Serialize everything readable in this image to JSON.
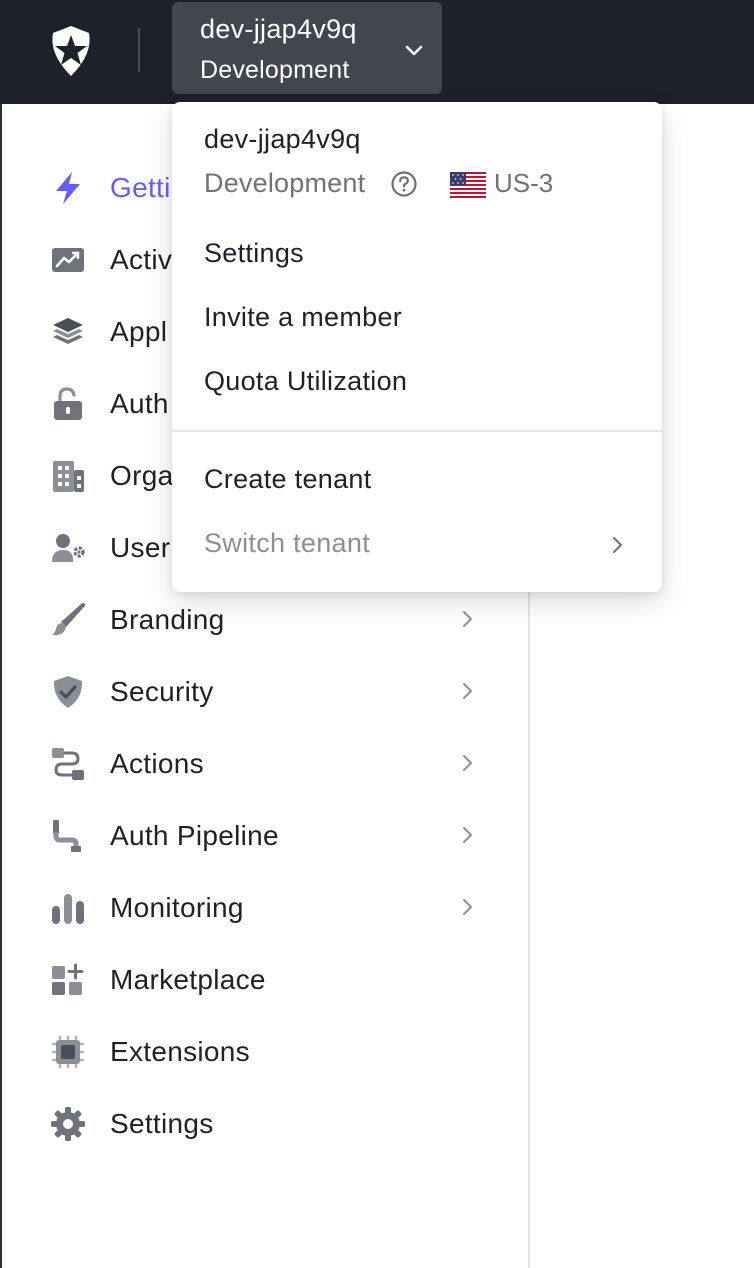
{
  "header": {
    "logo_icon": "auth0-shield-star-icon",
    "tenant_name": "dev-jjap4v9q",
    "tenant_env": "Development",
    "chevron_icon": "chevron-down-icon"
  },
  "tenant_menu": {
    "tenant_name": "dev-jjap4v9q",
    "environment": "Development",
    "help_icon": "question-circle-icon",
    "flag_icon": "us-flag-icon",
    "region": "US-3",
    "items": [
      {
        "label": "Settings"
      },
      {
        "label": "Invite a member"
      },
      {
        "label": "Quota Utilization"
      }
    ],
    "secondary_items": [
      {
        "label": "Create tenant",
        "disabled": false
      },
      {
        "label": "Switch tenant",
        "disabled": true,
        "has_submenu": true
      }
    ]
  },
  "sidebar": {
    "items": [
      {
        "label": "Getti",
        "icon": "lightning-bolt-icon",
        "active": true,
        "has_submenu": false
      },
      {
        "label": "Activ",
        "icon": "activity-chart-icon",
        "has_submenu": false
      },
      {
        "label": "Appl",
        "icon": "layers-stack-icon",
        "has_submenu": true
      },
      {
        "label": "Auth",
        "icon": "unlock-icon",
        "has_submenu": true
      },
      {
        "label": "Orga",
        "icon": "building-icon",
        "has_submenu": false
      },
      {
        "label": "User",
        "icon": "user-gear-icon",
        "has_submenu": true
      },
      {
        "label": "Branding",
        "icon": "paintbrush-icon",
        "has_submenu": true
      },
      {
        "label": "Security",
        "icon": "shield-check-icon",
        "has_submenu": true
      },
      {
        "label": "Actions",
        "icon": "actions-flow-icon",
        "has_submenu": true
      },
      {
        "label": "Auth Pipeline",
        "icon": "pipe-icon",
        "has_submenu": true
      },
      {
        "label": "Monitoring",
        "icon": "bar-chart-icon",
        "has_submenu": true
      },
      {
        "label": "Marketplace",
        "icon": "grid-plus-icon",
        "has_submenu": false
      },
      {
        "label": "Extensions",
        "icon": "chip-icon",
        "has_submenu": false
      },
      {
        "label": "Settings",
        "icon": "gear-icon",
        "has_submenu": false
      }
    ]
  },
  "colors": {
    "topbar_bg": "#1e212a",
    "accent": "#635dff",
    "icon_gray": "#6f727a"
  }
}
